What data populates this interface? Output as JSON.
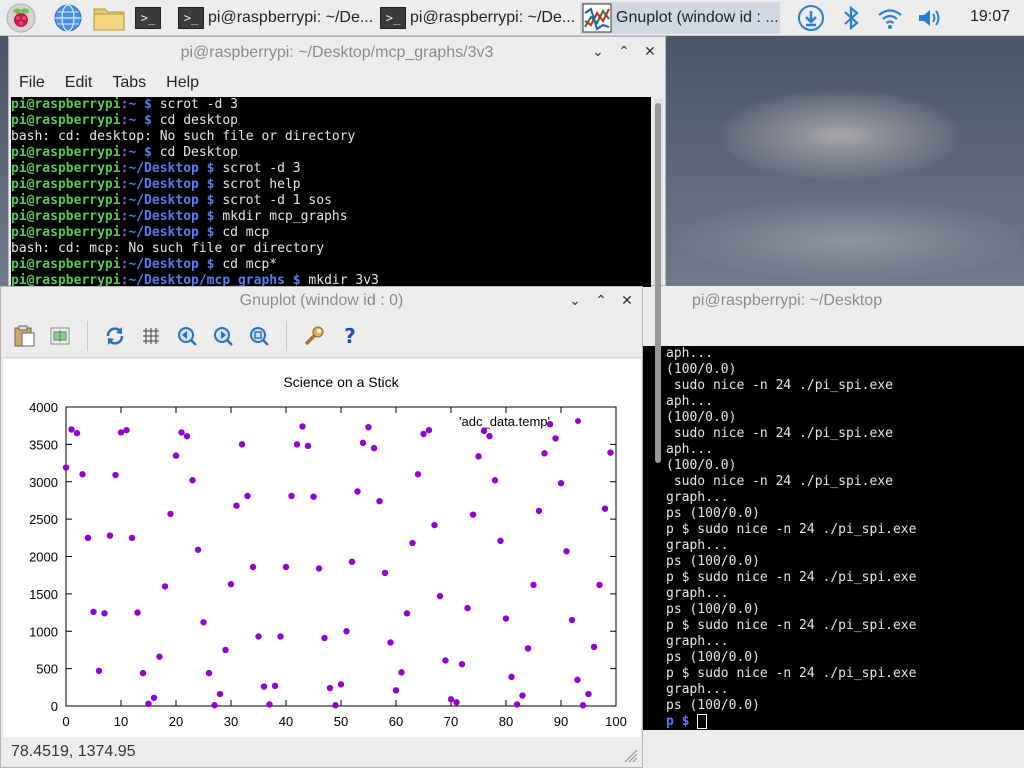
{
  "taskbar": {
    "tasks": [
      {
        "label": "pi@raspberrypi: ~/Desktop/mcp_graphs/3v3",
        "display": "pi@raspberrypi: ~/De..."
      },
      {
        "label": "pi@raspberrypi: ~/Desktop",
        "display": "pi@raspberrypi: ~/De..."
      },
      {
        "label": "Gnuplot (window id : 0)",
        "display": "Gnuplot (window id : ..."
      }
    ],
    "clock": "19:07",
    "term_glyph": ">_"
  },
  "terminal_top": {
    "title": "pi@raspberrypi: ~/Desktop/mcp_graphs/3v3",
    "menu": [
      "File",
      "Edit",
      "Tabs",
      "Help"
    ],
    "lines": [
      {
        "user": "pi@raspberrypi",
        "path": ":~ $ ",
        "cmd": "scrot -d 3"
      },
      {
        "user": "pi@raspberrypi",
        "path": ":~ $ ",
        "cmd": "cd desktop"
      },
      {
        "text": "bash: cd: desktop: No such file or directory"
      },
      {
        "user": "pi@raspberrypi",
        "path": ":~ $ ",
        "cmd": "cd Desktop"
      },
      {
        "user": "pi@raspberrypi",
        "path": ":~/Desktop $ ",
        "cmd": "scrot -d 3"
      },
      {
        "user": "pi@raspberrypi",
        "path": ":~/Desktop $ ",
        "cmd": "scrot help"
      },
      {
        "user": "pi@raspberrypi",
        "path": ":~/Desktop $ ",
        "cmd": "scrot -d 1 sos"
      },
      {
        "user": "pi@raspberrypi",
        "path": ":~/Desktop $ ",
        "cmd": "mkdir mcp_graphs"
      },
      {
        "user": "pi@raspberrypi",
        "path": ":~/Desktop $ ",
        "cmd": "cd mcp"
      },
      {
        "text": "bash: cd: mcp: No such file or directory"
      },
      {
        "user": "pi@raspberrypi",
        "path": ":~/Desktop $ ",
        "cmd": "cd mcp*"
      },
      {
        "user": "pi@raspberrypi",
        "path": ":~/Desktop/mcp_graphs $ ",
        "cmd": "mkdir 3v3"
      }
    ]
  },
  "terminal_right": {
    "title": "pi@raspberrypi: ~/Desktop",
    "lines": [
      "aph...",
      "(100/0.0)",
      " sudo nice -n 24 ./pi_spi.exe",
      "aph...",
      "(100/0.0)",
      " sudo nice -n 24 ./pi_spi.exe",
      "aph...",
      "(100/0.0)",
      " sudo nice -n 24 ./pi_spi.exe",
      "graph...",
      "ps (100/0.0)",
      "p $ sudo nice -n 24 ./pi_spi.exe",
      "graph...",
      "ps (100/0.0)",
      "p $ sudo nice -n 24 ./pi_spi.exe",
      "graph...",
      "ps (100/0.0)",
      "p $ sudo nice -n 24 ./pi_spi.exe",
      "graph...",
      "ps (100/0.0)",
      "p $ sudo nice -n 24 ./pi_spi.exe",
      "graph...",
      "ps (100/0.0)",
      "p $ "
    ]
  },
  "gnuplot": {
    "title": "Gnuplot (window id : 0)",
    "status": "78.4519,  1374.95"
  },
  "chart_data": {
    "type": "scatter",
    "title": "Science on a Stick",
    "xlabel": "",
    "ylabel": "",
    "xlim": [
      0,
      100
    ],
    "ylim": [
      0,
      4000
    ],
    "xticks": [
      0,
      10,
      20,
      30,
      40,
      50,
      60,
      70,
      80,
      90,
      100
    ],
    "yticks": [
      0,
      500,
      1000,
      1500,
      2000,
      2500,
      3000,
      3500,
      4000
    ],
    "point_color": "#9400d3",
    "grid": false,
    "series": [
      {
        "name": "'adc_data.temp'",
        "x": [
          0,
          1,
          2,
          3,
          4,
          5,
          6,
          7,
          8,
          9,
          10,
          11,
          12,
          13,
          14,
          15,
          16,
          17,
          18,
          19,
          20,
          21,
          22,
          23,
          24,
          25,
          26,
          27,
          28,
          29,
          30,
          31,
          32,
          33,
          34,
          35,
          36,
          37,
          38,
          39,
          40,
          41,
          42,
          43,
          44,
          45,
          46,
          47,
          48,
          49,
          50,
          51,
          52,
          53,
          54,
          55,
          56,
          57,
          58,
          59,
          60,
          61,
          62,
          63,
          64,
          65,
          66,
          67,
          68,
          69,
          70,
          71,
          72,
          73,
          74,
          75,
          76,
          77,
          78,
          79,
          80,
          81,
          82,
          83,
          84,
          85,
          86,
          87,
          88,
          89,
          90,
          91,
          92,
          93,
          94,
          95,
          96,
          97,
          98,
          99
        ],
        "y": [
          3190,
          3700,
          3650,
          3100,
          2250,
          1260,
          470,
          1240,
          2280,
          3090,
          3660,
          3690,
          2250,
          1250,
          440,
          30,
          110,
          660,
          1600,
          2570,
          3350,
          3660,
          3610,
          3020,
          2090,
          1120,
          440,
          10,
          160,
          750,
          1630,
          2680,
          3500,
          2810,
          1860,
          930,
          260,
          20,
          270,
          930,
          1860,
          2810,
          3500,
          3740,
          3480,
          2800,
          1840,
          910,
          240,
          10,
          290,
          1000,
          1930,
          2870,
          3520,
          3730,
          3450,
          2740,
          1780,
          850,
          210,
          450,
          1240,
          2180,
          3100,
          3640,
          3690,
          2420,
          1470,
          610,
          90,
          50,
          560,
          1310,
          2560,
          3340,
          3680,
          3610,
          3020,
          2210,
          1170,
          390,
          20,
          140,
          770,
          1620,
          2610,
          3380,
          3770,
          3580,
          2980,
          2070,
          1150,
          350,
          10,
          160,
          790,
          1620,
          2640,
          3390
        ]
      }
    ]
  }
}
